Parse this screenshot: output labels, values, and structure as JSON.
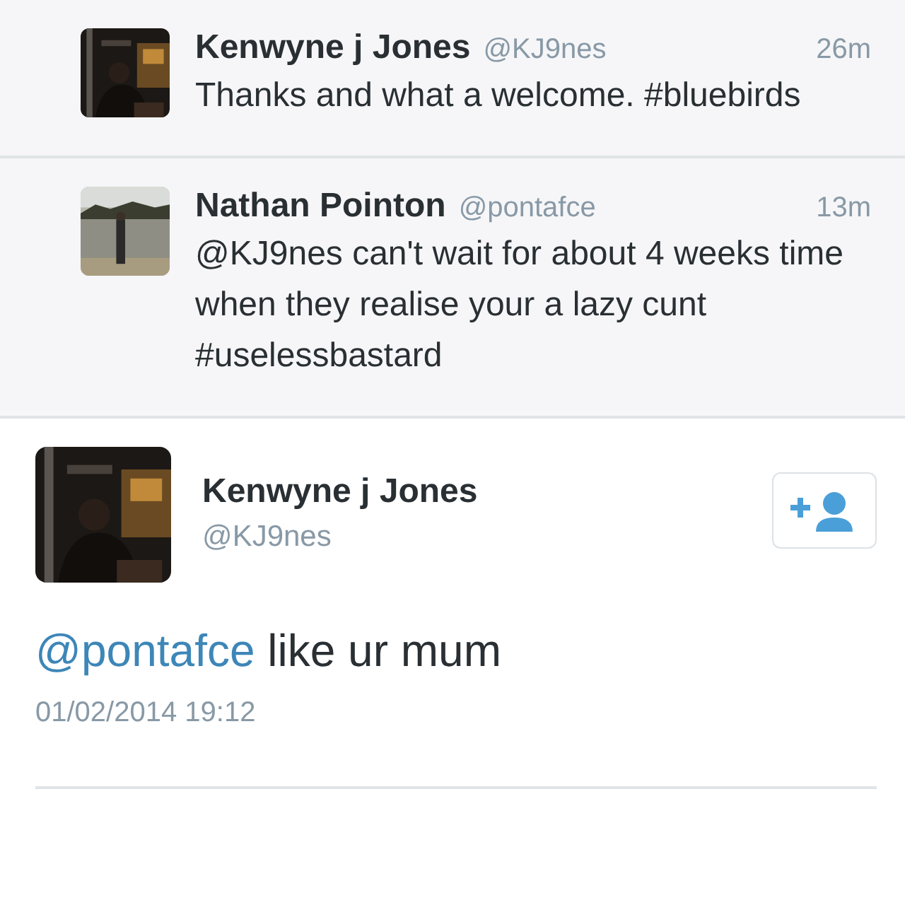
{
  "replies": [
    {
      "name": "Kenwyne j Jones",
      "handle": "@KJ9nes",
      "time": "26m",
      "text": "Thanks and what a welcome. #bluebirds"
    },
    {
      "name": "Nathan Pointon",
      "handle": "@pontafce",
      "time": "13m",
      "text": "@KJ9nes can't wait for about 4 weeks time when they realise your a lazy cunt #uselessbastard"
    }
  ],
  "tweet": {
    "name": "Kenwyne j Jones",
    "handle": "@KJ9nes",
    "mention": "@pontafce",
    "text": "like ur mum",
    "date": "01/02/2014 19:12"
  }
}
